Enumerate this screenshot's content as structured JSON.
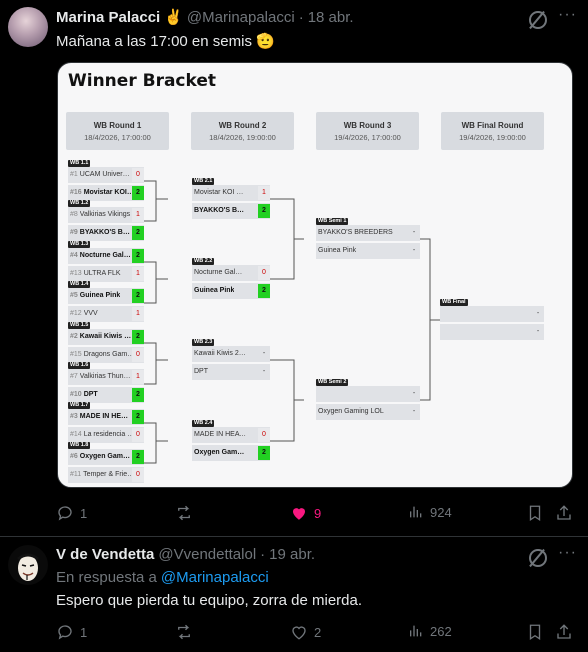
{
  "tweet1": {
    "author": "Marina Palacci",
    "author_emoji": "✌️",
    "handle": "@Marinapalacci",
    "separator": "·",
    "date": "18 abr.",
    "text": "Mañana a las 17:00 en semis 🫡",
    "more": "···",
    "actions": {
      "replies": "1",
      "reposts": "",
      "likes": "9",
      "views": "924"
    }
  },
  "bracket": {
    "title": "Winner Bracket",
    "rounds": [
      {
        "title": "WB Round 1",
        "date": "18/4/2026, 17:00:00"
      },
      {
        "title": "WB Round 2",
        "date": "18/4/2026, 19:00:00"
      },
      {
        "title": "WB Round 3",
        "date": "19/4/2026, 17:00:00"
      },
      {
        "title": "WB Final Round",
        "date": "19/4/2026, 19:00:00"
      }
    ],
    "matches": {
      "r1": [
        {
          "tag": "WB 1.1",
          "a": {
            "seed": "#1",
            "name": "UCAM University...",
            "score": "0"
          },
          "b": {
            "seed": "#16",
            "name": "Movistar KOI Ka...",
            "score": "2"
          }
        },
        {
          "tag": "WB 1.2",
          "a": {
            "seed": "#8",
            "name": "Valkirias Vikings",
            "score": "1"
          },
          "b": {
            "seed": "#9",
            "name": "BYAKKO'S BREEDE...",
            "score": "2"
          }
        },
        {
          "tag": "WB 1.3",
          "a": {
            "seed": "#4",
            "name": "Nocturne Gale L...",
            "score": "2"
          },
          "b": {
            "seed": "#13",
            "name": "ULTRA FLK",
            "score": "1"
          }
        },
        {
          "tag": "WB 1.4",
          "a": {
            "seed": "#5",
            "name": "Guinea Pink",
            "score": "2"
          },
          "b": {
            "seed": "#12",
            "name": "VVV",
            "score": "1"
          }
        },
        {
          "tag": "WB 1.5",
          "a": {
            "seed": "#2",
            "name": "Kawaii Kiwis 2026",
            "score": "2"
          },
          "b": {
            "seed": "#15",
            "name": "Dragons Gamin...",
            "score": "0"
          }
        },
        {
          "tag": "WB 1.6",
          "a": {
            "seed": "#7",
            "name": "Valkirias Thunde...",
            "score": "1"
          },
          "b": {
            "seed": "#10",
            "name": "DPT",
            "score": "2"
          }
        },
        {
          "tag": "WB 1.7",
          "a": {
            "seed": "#3",
            "name": "MADE IN HEAVEN",
            "score": "2"
          },
          "b": {
            "seed": "#14",
            "name": "La residencia 🇪🇺",
            "score": "0"
          }
        },
        {
          "tag": "WB 1.8",
          "a": {
            "seed": "#6",
            "name": "Oxygen Gaming ...",
            "score": "2"
          },
          "b": {
            "seed": "#11",
            "name": "Temper & Frien...",
            "score": "0"
          }
        }
      ],
      "r2": [
        {
          "tag": "WB 2.1",
          "a": {
            "name": "Movistar KOI Karps",
            "score": "1"
          },
          "b": {
            "name": "BYAKKO'S BREEDERS",
            "score": "2"
          }
        },
        {
          "tag": "WB 2.2",
          "a": {
            "name": "Nocturne Gale LOL",
            "score": "0"
          },
          "b": {
            "name": "Guinea Pink",
            "score": "2"
          }
        },
        {
          "tag": "WB 2.3",
          "a": {
            "name": "Kawaii Kiwis 2026",
            "score": "-"
          },
          "b": {
            "name": "DPT",
            "score": "-"
          }
        },
        {
          "tag": "WB 2.4",
          "a": {
            "name": "MADE IN HEAVEN",
            "score": "0"
          },
          "b": {
            "name": "Oxygen Gaming LOL",
            "score": "2"
          }
        }
      ],
      "r3": [
        {
          "tag": "WB Semi 1",
          "a": {
            "name": "BYAKKO'S BREEDERS",
            "score": "-"
          },
          "b": {
            "name": "Guinea Pink",
            "score": "-"
          }
        },
        {
          "tag": "WB Semi 2",
          "a": {
            "name": "",
            "score": "-"
          },
          "b": {
            "name": "Oxygen Gaming LOL",
            "score": "-"
          }
        }
      ],
      "r4": [
        {
          "tag": "WB Final",
          "a": {
            "name": "",
            "score": "-"
          },
          "b": {
            "name": "",
            "score": "-"
          }
        }
      ]
    }
  },
  "tweet2": {
    "author": "V de Vendetta",
    "handle": "@Vvendettalol",
    "separator": "·",
    "date": "19 abr.",
    "reply_prefix": "En respuesta a",
    "reply_to": "@Marinapalacci",
    "text": "Espero que pierda tu equipo, zorra de mierda.",
    "more": "···",
    "actions": {
      "replies": "1",
      "reposts": "",
      "likes": "2",
      "views": "262"
    }
  },
  "colors": {
    "accent": "#1d9bf0",
    "like": "#f91880",
    "win": "#22d022",
    "loss": "#cc0000"
  }
}
